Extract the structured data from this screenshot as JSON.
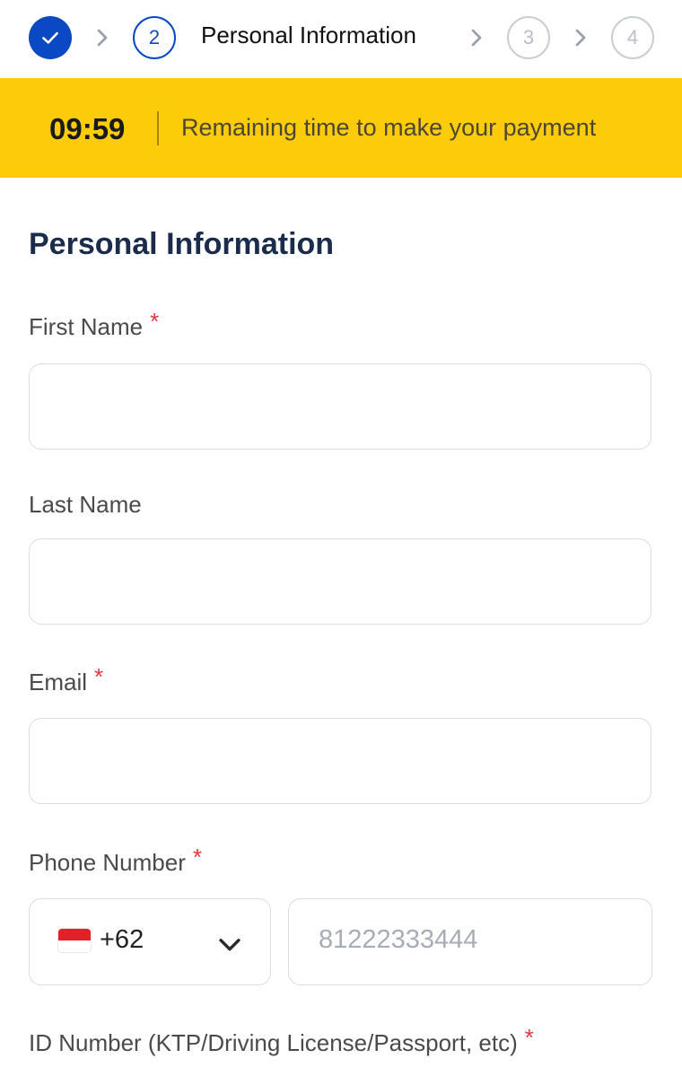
{
  "stepper": {
    "steps": [
      {
        "number": "",
        "state": "completed",
        "icon": "check-icon"
      },
      {
        "number": "2",
        "state": "active"
      },
      {
        "number": "3",
        "state": "inactive"
      },
      {
        "number": "4",
        "state": "inactive"
      }
    ],
    "active_title": "Personal Information",
    "separator_icon": "chevron-right-icon"
  },
  "timer": {
    "value": "09:59",
    "label": "Remaining time to make your payment"
  },
  "form": {
    "title": "Personal Information",
    "fields": {
      "first_name": {
        "label": "First Name",
        "required": true,
        "value": ""
      },
      "last_name": {
        "label": "Last Name",
        "required": false,
        "value": ""
      },
      "email": {
        "label": "Email",
        "required": true,
        "value": ""
      },
      "phone": {
        "label": "Phone Number",
        "required": true,
        "country_code": "+62",
        "country_flag": "indonesia-flag-icon",
        "placeholder": "81222333444",
        "value": ""
      },
      "id_number": {
        "label": "ID Number (KTP/Driving License/Passport, etc)",
        "required": true
      }
    },
    "required_marker": "*"
  },
  "colors": {
    "primary": "#0b48c4",
    "timer_bg": "#fccc0a",
    "title": "#1a2b4c",
    "required": "#e2373f",
    "border": "#dadde2"
  }
}
